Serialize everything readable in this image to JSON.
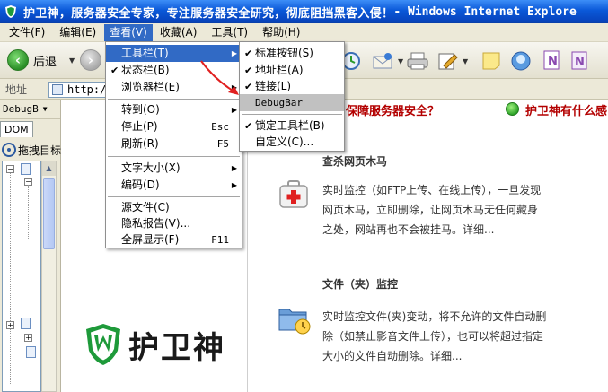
{
  "window": {
    "title_prefix": "护卫神，服务器安全专家，专注服务器安全研究，彻底阻挡黑客入侵！",
    "title_app": " - Windows Internet Explore"
  },
  "menubar": [
    {
      "label": "文件(F)"
    },
    {
      "label": "编辑(E)"
    },
    {
      "label": "查看(V)"
    },
    {
      "label": "收藏(A)"
    },
    {
      "label": "工具(T)"
    },
    {
      "label": "帮助(H)"
    }
  ],
  "toolbar": {
    "back_label": "后退",
    "icons": [
      "back-icon",
      "forward-icon",
      "history-icon",
      "mail-icon",
      "print-icon",
      "edit-icon",
      "note-icon",
      "messenger-icon",
      "onenote-icon",
      "onenote-2-icon"
    ]
  },
  "addressbar": {
    "label": "地址",
    "value": "http://"
  },
  "left_panel": {
    "title": "DebugB",
    "tab": "DOM",
    "drag_label": "拖拽目标"
  },
  "view_menu": {
    "items": [
      {
        "label": "工具栏(T)",
        "submenu": true,
        "state": "highlighted"
      },
      {
        "label": "状态栏(B)",
        "checked": true
      },
      {
        "label": "浏览器栏(E)",
        "submenu": true
      },
      {
        "label": "转到(O)",
        "submenu": true
      },
      {
        "label": "停止(P)",
        "shortcut": "Esc"
      },
      {
        "label": "刷新(R)",
        "shortcut": "F5"
      },
      {
        "label": "文字大小(X)",
        "submenu": true
      },
      {
        "label": "编码(D)",
        "submenu": true
      },
      {
        "label": "源文件(C)"
      },
      {
        "label": "隐私报告(V)..."
      },
      {
        "label": "全屏显示(F)",
        "shortcut": "F11"
      }
    ]
  },
  "toolbars_submenu": {
    "items": [
      {
        "label": "标准按钮(S)",
        "checked": true
      },
      {
        "label": "地址栏(A)",
        "checked": true
      },
      {
        "label": "链接(L)",
        "checked": true
      },
      {
        "label": "DebugBar",
        "state": "hover"
      },
      {
        "label": "锁定工具栏(B)",
        "checked": true
      },
      {
        "label": "自定义(C)..."
      }
    ]
  },
  "page": {
    "banner_1": "保障服务器安全？",
    "banner_2": "护卫神有什么感",
    "feature_1": {
      "title": "查杀网页木马",
      "desc": "实时监控（如FTP上传、在线上传），一旦发现网页木马，立即删除，让网页木马无任何藏身之处，网站再也不会被挂马。详细..."
    },
    "feature_2": {
      "title": "文件（夹）监控",
      "desc": "实时监控文件(夹)变动，将不允许的文件自动删除（如禁止影音文件上传），也可以将超过指定大小的文件自动删除。详细..."
    },
    "logo_text": "护卫神"
  },
  "colors": {
    "title_bar": "#0a58d8",
    "menu_highlight": "#316ac5",
    "banner_red": "#b30000",
    "logo_green": "#1e9a3a",
    "arrow_red": "#e02020"
  }
}
